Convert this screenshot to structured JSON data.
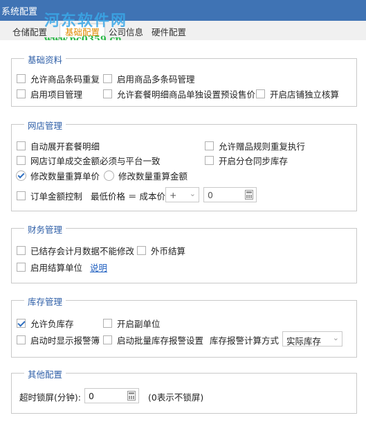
{
  "window": {
    "title": "系统配置"
  },
  "watermark": {
    "line1": "河东软件网",
    "line2": "www.pc0359.cn"
  },
  "tabs": [
    {
      "label": "仓储配置"
    },
    {
      "label": "基础配置"
    },
    {
      "label": "公司信息"
    },
    {
      "label": "硬件配置"
    }
  ],
  "basic": {
    "title": "基础资料",
    "allow_dup_barcode": "允许商品条码重复",
    "multi_barcode": "启用商品多条码管理",
    "project_mgmt": "启用项目管理",
    "combo_preset_price": "允许套餐明细商品单独设置预设售价",
    "store_independent": "开启店铺独立核算"
  },
  "online": {
    "title": "网店管理",
    "auto_expand_combo": "自动展开套餐明细",
    "gift_rule_repeat": "允许赠品规则重复执行",
    "order_amount_match": "网店订单成交金额必须与平台一致",
    "split_stock_sync": "开启分仓同步库存",
    "radio_unit_price": "修改数量重算单价",
    "radio_amount": "修改数量重算金额",
    "order_amount_ctrl": "订单金额控制",
    "min_price_label": "最低价格 ＝ 成本价",
    "op_value": "+",
    "amount_value": "0"
  },
  "finance": {
    "title": "财务管理",
    "closed_month_lock": "已结存会计月数据不能修改",
    "foreign_currency": "外币结算",
    "settlement_unit": "启用结算单位",
    "explain_link": "说明"
  },
  "stock": {
    "title": "库存管理",
    "allow_negative": "允许负库存",
    "aux_unit": "开启副单位",
    "startup_alert": "启动时显示报警簿",
    "batch_alert": "启动批量库存报警设置",
    "calc_method_label": "库存报警计算方式",
    "calc_method_value": "实际库存"
  },
  "other": {
    "title": "其他配置",
    "timeout_label": "超时锁屏(分钟):",
    "timeout_value": "0",
    "timeout_hint": "(0表示不锁屏)"
  }
}
